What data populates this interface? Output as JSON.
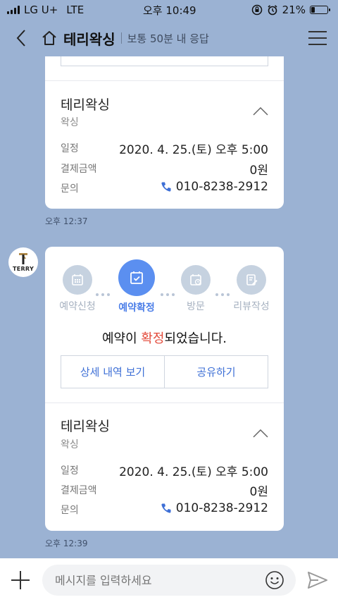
{
  "status_bar": {
    "carrier": "LG U+",
    "network": "LTE",
    "time": "오후 10:49",
    "battery": "21%",
    "battery_level": 0.21
  },
  "header": {
    "title": "테리왁싱",
    "subtitle": "보통 50분 내 응답"
  },
  "top_card": {
    "business_name": "테리왁싱",
    "category": "왁싱",
    "rows": [
      {
        "label": "일정",
        "value": "2020. 4. 25.(토) 오후 5:00"
      },
      {
        "label": "결제금액",
        "value": "0원"
      },
      {
        "label": "문의",
        "value": "010-8238-2912"
      }
    ],
    "timestamp": "오후 12:37"
  },
  "avatar": {
    "text": "TERRY"
  },
  "main_card": {
    "steps": [
      {
        "label": "예약신청",
        "icon": "calendar-grid-icon",
        "active": false
      },
      {
        "label": "예약확정",
        "icon": "calendar-check-icon",
        "active": true
      },
      {
        "label": "방문",
        "icon": "calendar-clock-icon",
        "active": false
      },
      {
        "label": "리뷰작성",
        "icon": "review-edit-icon",
        "active": false
      }
    ],
    "message_prefix": "예약이 ",
    "message_highlight": "확정",
    "message_suffix": "되었습니다.",
    "buttons": {
      "details": "상세 내역 보기",
      "share": "공유하기"
    },
    "business_name": "테리왁싱",
    "category": "왁싱",
    "rows": [
      {
        "label": "일정",
        "value": "2020. 4. 25.(토) 오후 5:00"
      },
      {
        "label": "결제금액",
        "value": "0원"
      },
      {
        "label": "문의",
        "value": "010-8238-2912"
      }
    ],
    "timestamp": "오후 12:39"
  },
  "input_bar": {
    "placeholder": "메시지를 입력하세요"
  },
  "colors": {
    "background": "#9bb2d3",
    "accent": "#5b8ff0",
    "highlight": "#e34a3a",
    "link": "#3d6fd6"
  }
}
